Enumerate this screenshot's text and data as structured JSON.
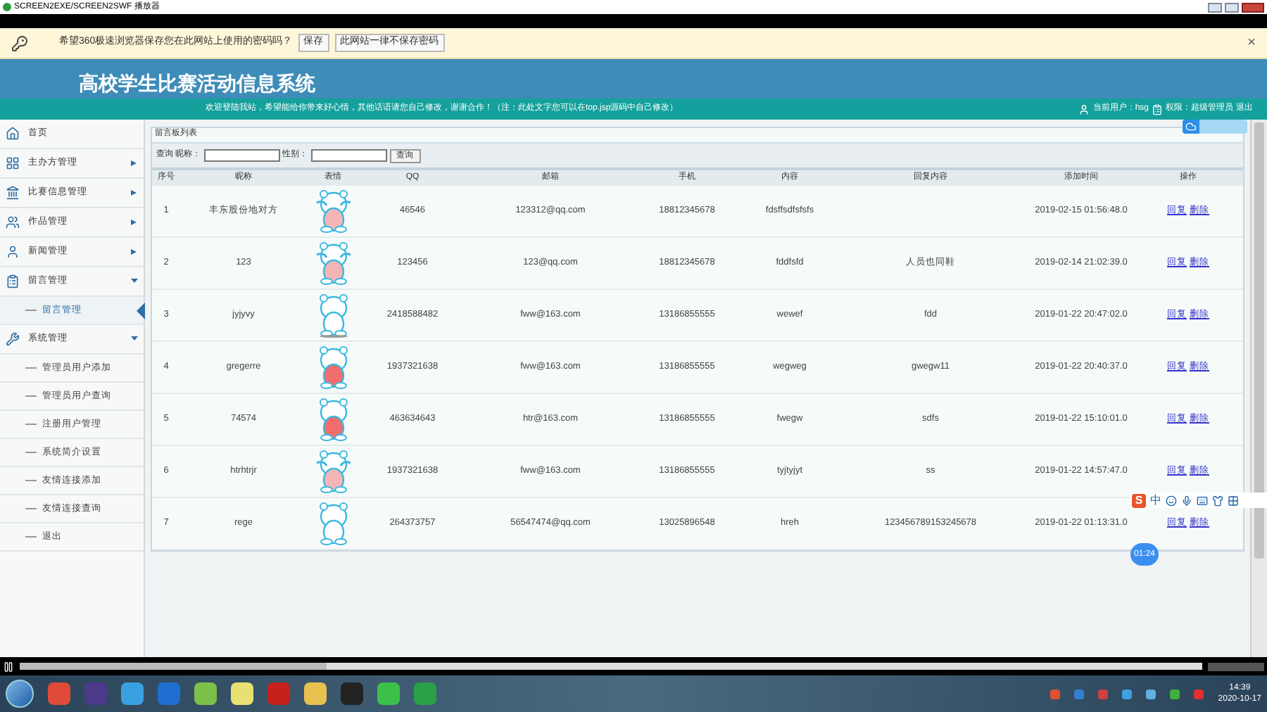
{
  "player": {
    "title": "SCREEN2EXE/SCREEN2SWF 播放器",
    "progress": {
      "level": 0.26
    }
  },
  "password_bar": {
    "message": "希望360极速浏览器保存您在此网站上使用的密码吗？",
    "buttons": [
      "保存",
      "此网站一律不保存密码"
    ],
    "close": "×"
  },
  "header": {
    "title": "高校学生比赛活动信息系统",
    "welcome": "欢迎登陆我站，希望能给你带来好心情，其他话语请您自己修改，谢谢合作！（注：此处文字您可以在top.jsp源码中自己修改）",
    "user": "当前用户：hsg",
    "role": "权限：超级管理员",
    "logout": "退出"
  },
  "sidebar": {
    "items": [
      {
        "label": "首页"
      },
      {
        "label": "主办方管理",
        "expanded": false
      },
      {
        "label": "比赛信息管理",
        "expanded": false
      },
      {
        "label": "作品管理",
        "expanded": false
      },
      {
        "label": "新闻管理",
        "expanded": false
      },
      {
        "label": "留言管理",
        "expanded": true,
        "children": [
          {
            "label": "留言管理",
            "selected": true
          }
        ]
      },
      {
        "label": "系统管理",
        "expanded": true,
        "children": [
          {
            "label": "管理员用户添加",
            "selected": false
          },
          {
            "label": "管理员用户查询",
            "selected": false
          },
          {
            "label": "注册用户管理",
            "selected": false
          },
          {
            "label": "系统简介设置",
            "selected": false
          },
          {
            "label": "友情连接添加",
            "selected": false
          },
          {
            "label": "友情连接查询",
            "selected": false
          },
          {
            "label": "退出",
            "selected": false
          }
        ]
      }
    ]
  },
  "panel": {
    "title": "留言板列表",
    "search": {
      "label": "查询 昵称：",
      "field2_label": "性别：",
      "button": "查询"
    }
  },
  "table": {
    "columns": [
      "序号",
      "昵称",
      "表情",
      "QQ",
      "邮箱",
      "手机",
      "内容",
      "回复内容",
      "添加时间",
      "操作"
    ],
    "rows": [
      {
        "no": "1",
        "nick": "丰东股份地对方",
        "actions": [
          "回复",
          "删除"
        ],
        "qq": "46546",
        "email": "123312@qq.com",
        "phone": "18812345678",
        "content": "fdsffsdfsfsfs",
        "time": "2019-02-15 01:56:48.0"
      },
      {
        "no": "2",
        "nick": "123",
        "actions": [
          "回复",
          "删除"
        ],
        "qq": "123456",
        "email": "123@qq.com",
        "phone": "18812345678",
        "content": "fddfsfd",
        "reply": "人员也同鞋",
        "time": "2019-02-14 21:02:39.0"
      },
      {
        "no": "3",
        "nick": "jyjyvy",
        "actions": [
          "回复",
          "删除"
        ],
        "qq": "2418588482",
        "email": "fww@163.com",
        "phone": "13186855555",
        "content": "wewef",
        "reply": "fdd",
        "time": "2019-01-22 20:47:02.0"
      },
      {
        "no": "4",
        "nick": "gregerre",
        "actions": [
          "回复",
          "删除"
        ],
        "qq": "1937321638",
        "email": "fww@163.com",
        "phone": "13186855555",
        "content": "wegweg",
        "reply": "gwegw11",
        "time": "2019-01-22 20:40:37.0"
      },
      {
        "no": "5",
        "nick": "74574",
        "actions": [
          "回复",
          "删除"
        ],
        "qq": "463634643",
        "email": "htr@163.com",
        "phone": "13186855555",
        "content": "fwegw",
        "reply": "sdfs",
        "time": "2019-01-22 15:10:01.0"
      },
      {
        "no": "6",
        "nick": "htrhtrjr",
        "actions": [
          "回复",
          "删除"
        ],
        "qq": "1937321638",
        "email": "fww@163.com",
        "phone": "13186855555",
        "content": "tyjtyjyt",
        "reply": "ss",
        "time": "2019-01-22 14:57:47.0"
      },
      {
        "no": "7",
        "nick": "rege",
        "actions": [
          "回复",
          "删除"
        ],
        "qq": "264373757",
        "email": "56547474@qq.com",
        "phone": "13025896548",
        "content": "hreh",
        "reply": "123456789153245678",
        "time": "2019-01-22 01:13:31.0"
      }
    ]
  },
  "ime_bar": {
    "logo": "S",
    "mode": "中"
  },
  "timer": "01:24",
  "taskbar": {
    "time": "14:39",
    "date": "2020-10-17"
  }
}
